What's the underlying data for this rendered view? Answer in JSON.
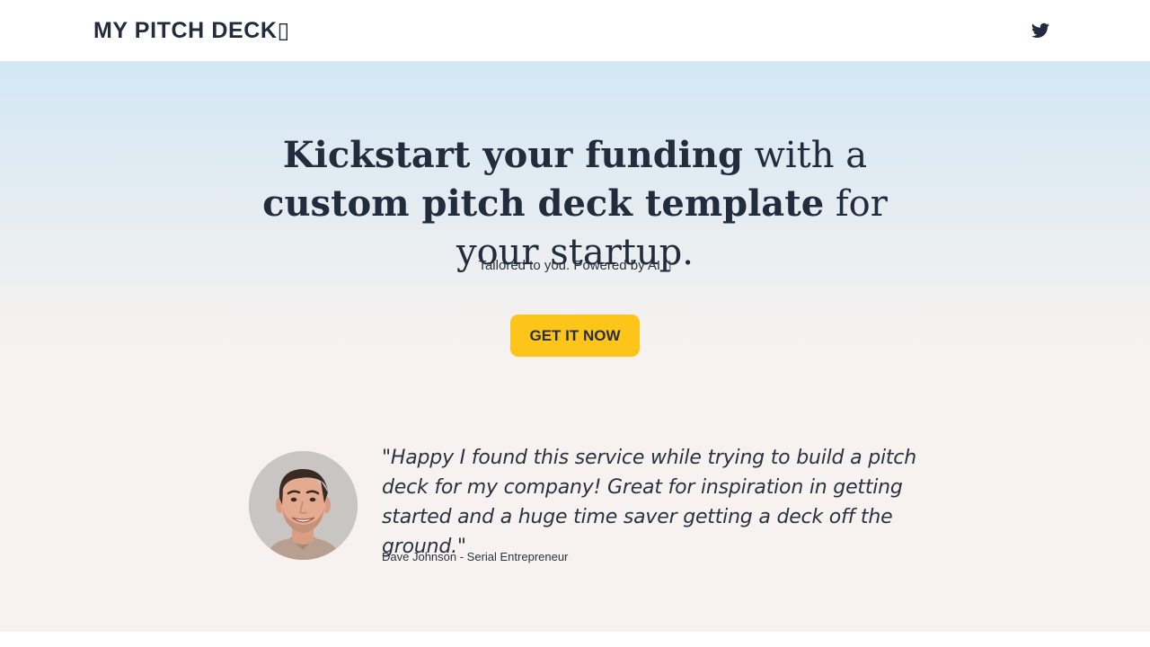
{
  "header": {
    "logo_text": "MY PITCH DECK▯",
    "social_icon": "twitter-icon"
  },
  "hero": {
    "headline_part1": "Kickstart your funding",
    "headline_part2": " with a ",
    "headline_part3": "custom pitch deck template",
    "headline_part4": " for your startup.",
    "tagline": "Tailored to you. Powered by AI ▯",
    "cta_label": "GET IT NOW"
  },
  "testimonial": {
    "quote": "\"Happy I found this service while trying to build a pitch deck for my company! Great for inspiration in getting started and a huge time saver getting a deck off the ground.\"",
    "author": "Dave Johnson - Serial Entrepreneur"
  },
  "colors": {
    "text": "#222c3c",
    "cta": "#fdc51a",
    "hero_top": "#d3e7f4",
    "hero_bottom": "#f7f2ef"
  }
}
